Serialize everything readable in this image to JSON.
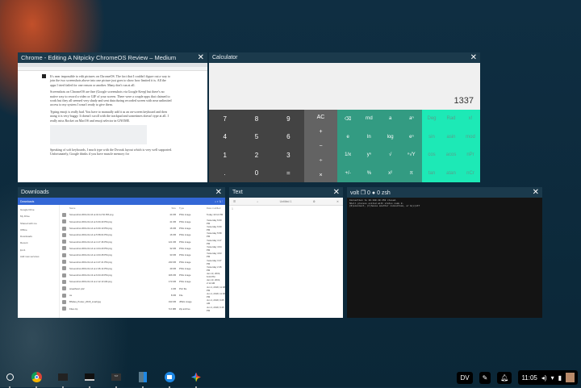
{
  "windows": {
    "chrome": {
      "title": "Chrome - Editing A Nitpicky ChromeOS Review – Medium",
      "paragraphs": [
        "It's near impossible to edit pictures on ChromeOS. The fact that I couldn't figure out a way to join the two screenshots above into one picture just goes to show how limited it is. All the apps I tried failed for one reason or another. Many don't run at all.",
        "Screenshots on ChromeOS are fine (Google screenshots via Google Keep) but there's no native way to record a video or GIF of your screen. There were a couple apps that claimed to work but they all seemed very shady and sent data during recorded screen with near unlimited access to my system I wasn't ready to give them.",
        "Typing emoji is really bad. You have to manually add it as an on-screen keyboard and then using it is very buggy. It doesn't scroll with the trackpad and sometimes doesn't type at all. I really miss Rocket on MacOS and emoji selector in GNOME.",
        "Speaking of soft keyboards, I much type with the Dvorak layout which is very well supported. Unfortunately, Google thinks if you have muscle memory for"
      ]
    },
    "calculator": {
      "title": "Calculator",
      "display": "1337",
      "numpad": [
        "7",
        "8",
        "9",
        "4",
        "5",
        "6",
        "1",
        "2",
        "3",
        ".",
        "0",
        "="
      ],
      "ops": [
        "AC",
        "+",
        "−",
        "÷",
        "×"
      ],
      "sci": [
        "⌫",
        "rnd",
        "a",
        "aⁿ",
        "e",
        "ln",
        "log",
        "eⁿ",
        "1/x",
        "yⁿ",
        "√",
        "ⁿ√Y",
        "+/-",
        "%",
        "x²",
        "π"
      ],
      "adv": [
        "Deg",
        "Rad",
        "x!",
        "sin",
        "asin",
        "mod",
        "cos",
        "acos",
        "nPr",
        "tan",
        "atan",
        "nCr"
      ]
    },
    "downloads": {
      "title": "Downloads",
      "toolbar_label": "Downloads",
      "sidebar": [
        "Google Drive",
        "My Drive",
        "Shared with me",
        "Offline",
        "Downloads",
        "Recent",
        "lpm1",
        "Add new services"
      ],
      "columns": [
        "Name",
        "Size",
        "Type",
        "Date modified"
      ],
      "files": [
        [
          "Screenshot 2019-01-16 at 10.12.52 PM.png",
          "44 KB",
          "PNG image",
          "Today 10:12 PM"
        ],
        [
          "Screenshot 2019-01-14 at 6.00.40 PM.png",
          "41 KB",
          "PNG image",
          "Yesterday 6:00 PM"
        ],
        [
          "Screenshot 2019-01-14 at 6.00.10 PM.png",
          "16 KB",
          "PNG image",
          "Yesterday 6:00 PM"
        ],
        [
          "Screenshot 2019-01-14 at 5.58.04 PM.png",
          "16 KB",
          "PNG image",
          "Yesterday 5:58 PM"
        ],
        [
          "Screenshot 2019-01-14 at 4.17.46 PM.png",
          "121 KB",
          "PNG image",
          "Yesterday 4:17 PM"
        ],
        [
          "Screenshot 2019-01-14 at 4.04.29 PM.png",
          "32 KB",
          "PNG image",
          "Yesterday 4:04 PM"
        ],
        [
          "Screenshot 2019-01-14 at 4.03.28 PM.png",
          "33 KB",
          "PNG image",
          "Yesterday 4:03 PM"
        ],
        [
          "Screenshot 2019-01-14 at 3.47.21 PM.png",
          "233 KB",
          "PNG image",
          "Yesterday 3:47 PM"
        ],
        [
          "Screenshot 2019-01-14 at 2.46.14 PM.png",
          "49 KB",
          "PNG image",
          "Yesterday 2:46 PM"
        ],
        [
          "Screenshot 2019-01-13 at 6.03.29 PM.png",
          "406 KB",
          "PNG image",
          "Jan 13, 2019, 6:03 PM"
        ],
        [
          "Screenshot 2019-01-13 at 2.12.13 AM.png",
          "173 KB",
          "PNG image",
          "Jan 13, 2019, 2:12 AM"
        ],
        [
          "wreathcert.p12",
          "4 KB",
          "P12 file",
          "Jun 4, 2018, 11:38 PM"
        ],
        [
          "ca",
          "8 KB",
          "File",
          "Jun 4, 2018, 11:30 PM"
        ],
        [
          "BSides_Poster_2018_small.jpg",
          "193 KB",
          "JPEG image",
          "Jun 4, 2018, 9:25 AM"
        ],
        [
          "Files.zip",
          "5.6 MB",
          "Zip archive",
          "Jun 3, 2018, 6:15 PM"
        ]
      ]
    },
    "text": {
      "title": "Text",
      "tab": "Untitled 1",
      "line": "1"
    },
    "terminal": {
      "title": "volt ❐ 0 ● 0 zsh",
      "lines": [
        "Connection to 10.100.10.152 closed.",
        "Shell process exited with status code 0.",
        "(R)econnect, (C)hoose another connection, or E(x)it?"
      ]
    }
  },
  "shelf": {
    "apps": [
      "launcher",
      "chrome",
      "terminal-crosh",
      "terminal",
      "ssh",
      "calculator",
      "files",
      "photos"
    ],
    "tray": {
      "ime": "DV",
      "time": "11:05"
    }
  },
  "colors": {
    "window_header": "#1b3a4c",
    "calc_sci": "#339b82",
    "calc_adv": "#1de9b6",
    "files_accent": "#3367d6"
  }
}
